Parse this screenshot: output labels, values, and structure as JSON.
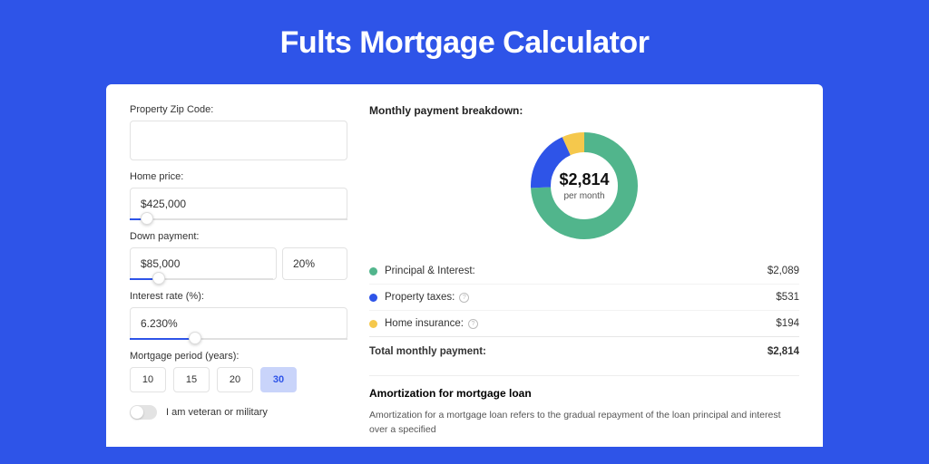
{
  "title": "Fults Mortgage Calculator",
  "form": {
    "zip_label": "Property Zip Code:",
    "zip_value": "",
    "price_label": "Home price:",
    "price_value": "$425,000",
    "price_slider_pct": 8,
    "down_label": "Down payment:",
    "down_value": "$85,000",
    "down_pct": "20%",
    "down_slider_pct": 20,
    "rate_label": "Interest rate (%):",
    "rate_value": "6.230%",
    "rate_slider_pct": 30,
    "period_label": "Mortgage period (years):",
    "periods": [
      "10",
      "15",
      "20",
      "30"
    ],
    "period_selected": "30",
    "veteran_label": "I am veteran or military"
  },
  "breakdown": {
    "title": "Monthly payment breakdown:",
    "total_display": "$2,814",
    "total_sub": "per month",
    "items": [
      {
        "label": "Principal & Interest:",
        "amount": "$2,089",
        "color": "#51b58c",
        "value": 2089,
        "has_info": false
      },
      {
        "label": "Property taxes:",
        "amount": "$531",
        "color": "#2e54e8",
        "value": 531,
        "has_info": true
      },
      {
        "label": "Home insurance:",
        "amount": "$194",
        "color": "#f5c84c",
        "value": 194,
        "has_info": true
      }
    ],
    "total_label": "Total monthly payment:",
    "total_amount": "$2,814"
  },
  "amortization": {
    "title": "Amortization for mortgage loan",
    "text": "Amortization for a mortgage loan refers to the gradual repayment of the loan principal and interest over a specified"
  },
  "chart_data": {
    "type": "pie",
    "title": "Monthly payment breakdown",
    "series": [
      {
        "name": "Principal & Interest",
        "value": 2089,
        "color": "#51b58c"
      },
      {
        "name": "Property taxes",
        "value": 531,
        "color": "#2e54e8"
      },
      {
        "name": "Home insurance",
        "value": 194,
        "color": "#f5c84c"
      }
    ],
    "total": 2814,
    "center_label": "$2,814 per month"
  }
}
